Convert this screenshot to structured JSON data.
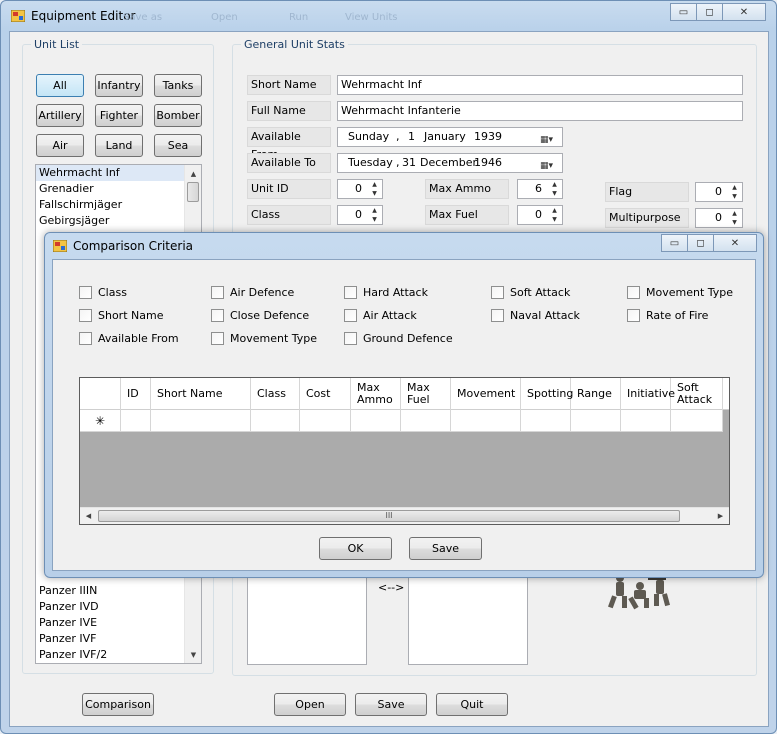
{
  "main_window": {
    "title": "Equipment Editor",
    "ghost_menu": [
      "Save as",
      "Open",
      "Run",
      "View Units"
    ],
    "caption": {
      "minimize": "▭",
      "maximize": "◻",
      "close": "✕"
    }
  },
  "unit_list": {
    "title": "Unit List",
    "filters": [
      "All",
      "Infantry",
      "Tanks",
      "Artillery",
      "Fighter",
      "Bomber",
      "Air",
      "Land",
      "Sea"
    ],
    "items_top": [
      "Wehrmacht Inf",
      "Grenadier",
      "Fallschirmjäger",
      "Gebirgsjäger"
    ],
    "items_bottom": [
      "Panzer IIIN",
      "Panzer IVD",
      "Panzer IVE",
      "Panzer IVF",
      "Panzer IVF/2"
    ]
  },
  "general_stats": {
    "title": "General Unit Stats",
    "short_name_label": "Short Name",
    "short_name": "Wehrmacht Inf",
    "full_name_label": "Full Name",
    "full_name": "Wehrmacht Infanterie",
    "available_from_label": "Available From",
    "available_from": {
      "day": "Sunday",
      "date": "1",
      "month": "January",
      "year": "1939"
    },
    "available_to_label": "Available To",
    "available_to": {
      "day": "Tuesday",
      "date": "31",
      "month": "December",
      "year": "1946"
    },
    "unit_id_label": "Unit ID",
    "unit_id": "0",
    "class_label": "Class",
    "class": "0",
    "max_ammo_label": "Max Ammo",
    "max_ammo": "6",
    "max_fuel_label": "Max Fuel",
    "max_fuel": "0",
    "flag_label": "Flag",
    "flag": "0",
    "multipurpose_label": "Multipurpose",
    "multipurpose": "0",
    "swap_arrow": "<-->"
  },
  "bottom_buttons": {
    "comparison": "Comparison",
    "open": "Open",
    "save": "Save",
    "quit": "Quit"
  },
  "dialog": {
    "title": "Comparison Criteria",
    "checkboxes": [
      [
        "Class",
        "Short Name",
        "Available From"
      ],
      [
        "Air Defence",
        "Close Defence",
        "Movement Type"
      ],
      [
        "Hard Attack",
        "Air Attack",
        "Ground Defence"
      ],
      [
        "Soft Attack",
        "Naval Attack"
      ],
      [
        "Movement Type",
        "Rate of Fire"
      ]
    ],
    "grid_columns": [
      "ID",
      "Short Name",
      "Class",
      "Cost",
      "Max Ammo",
      "Max Fuel",
      "Movement",
      "Spotting",
      "Range",
      "Initiative",
      "Soft Attack"
    ],
    "new_row_marker": "✳",
    "scroll_grip": "III",
    "ok": "OK",
    "save": "Save"
  }
}
